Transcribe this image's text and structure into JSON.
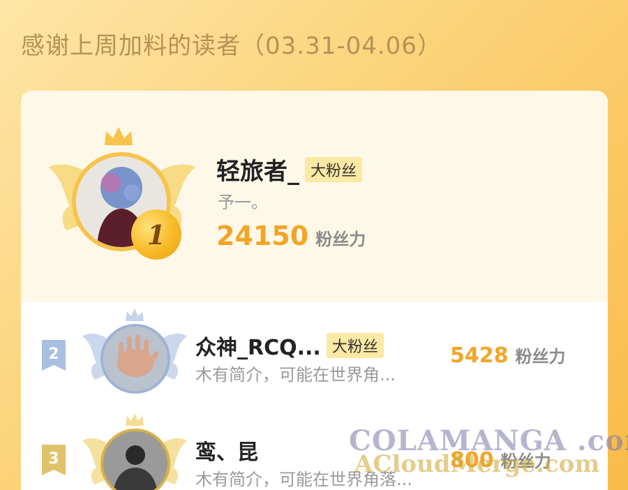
{
  "header": {
    "title": "感谢上周加料的读者（03.31-04.06）"
  },
  "top1": {
    "rank": "1",
    "name": "轻旅者_",
    "badge": "大粉丝",
    "bio": "予一。",
    "score": "24150",
    "score_unit": "粉丝力"
  },
  "ranks": [
    {
      "rank": "2",
      "name": "众神_RCQ...",
      "badge": "大粉丝",
      "bio": "木有简介，可能在世界角...",
      "score": "5428",
      "score_unit": "粉丝力"
    },
    {
      "rank": "3",
      "name": "鸾、昆",
      "badge": "",
      "bio": "木有简介，可能在世界角落...",
      "score": "800",
      "score_unit": "粉丝力"
    }
  ],
  "watermark": {
    "line1": "COLAMANGA .com",
    "line2": "ACloudMerge.com"
  },
  "colors": {
    "accent": "#f3a526",
    "title": "#b59255",
    "badge_bg": "#fbe9a4",
    "silver": "#9fb3d4",
    "bronze": "#d7b14a"
  }
}
